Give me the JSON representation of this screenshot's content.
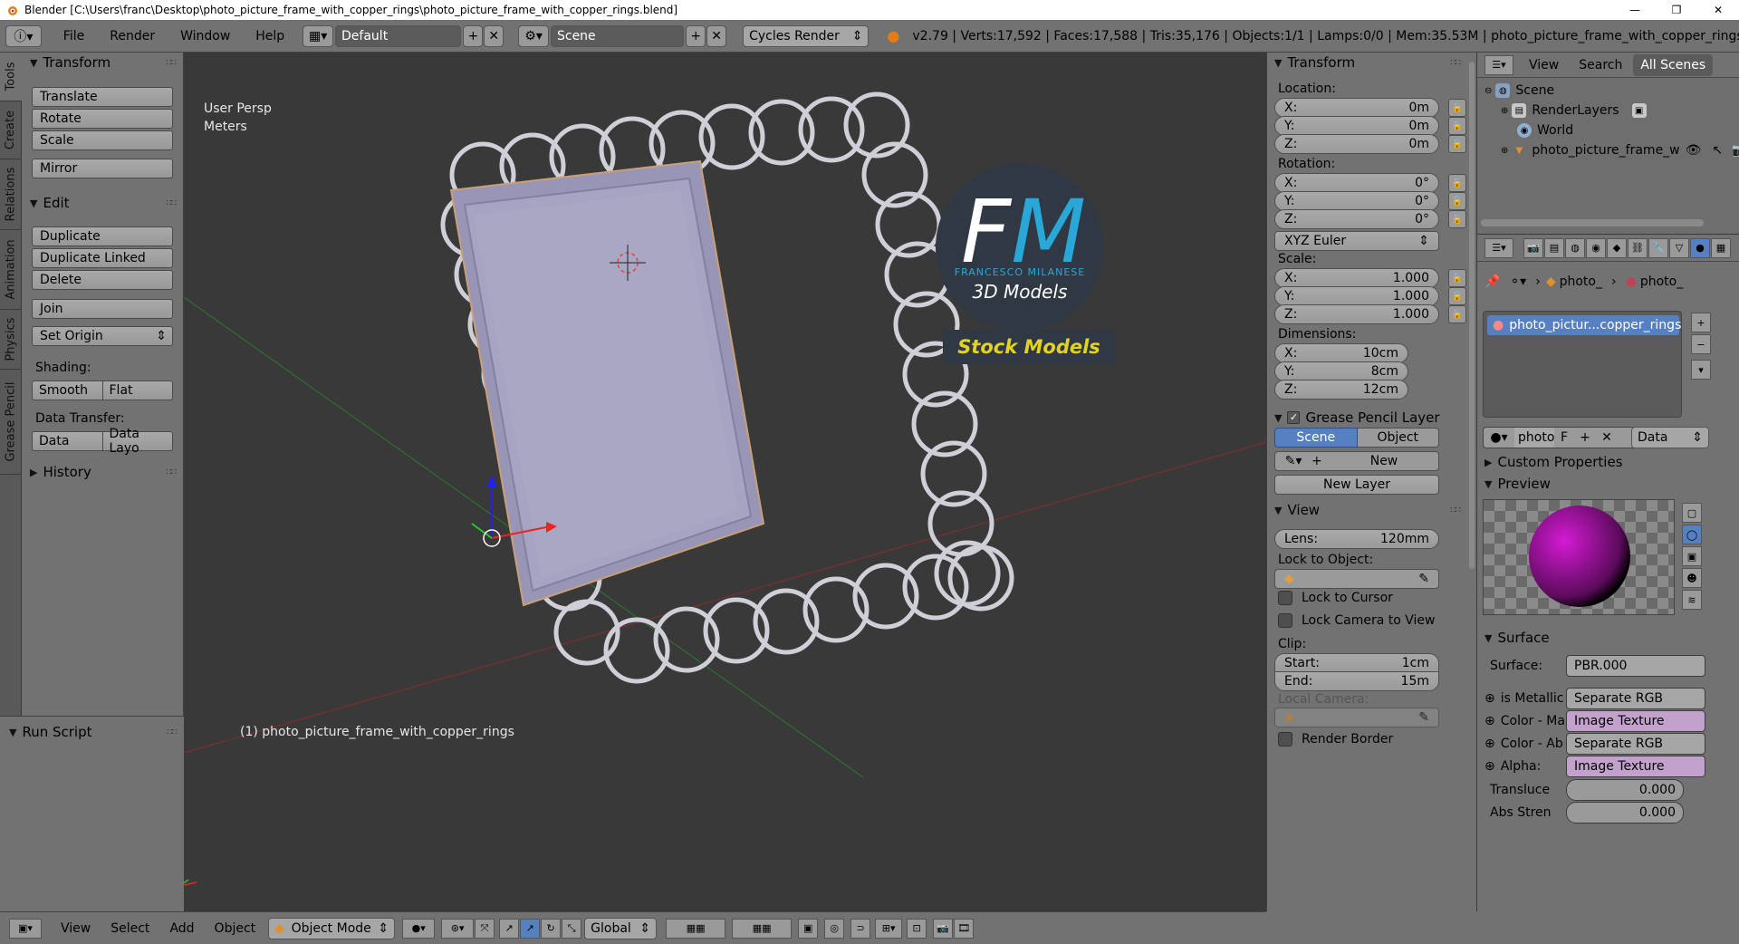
{
  "window": {
    "title": "Blender [C:\\Users\\franc\\Desktop\\photo_picture_frame_with_copper_rings\\photo_picture_frame_with_copper_rings.blend]",
    "minimize": "—",
    "maximize": "❐",
    "close": "✕"
  },
  "infobar": {
    "menus": [
      "File",
      "Render",
      "Window",
      "Help"
    ],
    "layout": "Default",
    "scene": "Scene",
    "engine": "Cycles Render",
    "stats": "v2.79 | Verts:17,592 | Faces:17,588 | Tris:35,176 | Objects:1/1 | Lamps:0/0 | Mem:35.53M | photo_picture_frame_with_copper_rings"
  },
  "vtabs": [
    "Tools",
    "Create",
    "Relations",
    "Animation",
    "Physics",
    "Grease Pencil"
  ],
  "toolshelf": {
    "transform_header": "Transform",
    "translate": "Translate",
    "rotate": "Rotate",
    "scale": "Scale",
    "mirror": "Mirror",
    "edit_header": "Edit",
    "duplicate": "Duplicate",
    "duplicate_linked": "Duplicate Linked",
    "delete": "Delete",
    "join": "Join",
    "set_origin": "Set Origin",
    "shading_label": "Shading:",
    "smooth": "Smooth",
    "flat": "Flat",
    "data_transfer_label": "Data Transfer:",
    "data": "Data",
    "data_layo": "Data Layo",
    "history_header": "History",
    "run_script_header": "Run Script"
  },
  "viewport": {
    "persp": "User Persp",
    "units": "Meters",
    "object_label": "(1) photo_picture_frame_with_copper_rings",
    "watermark": {
      "fm_f": "F",
      "fm_m": "M",
      "brand": "FRANCESCO MILANESE",
      "models": "3D Models",
      "stock": "Stock Models"
    }
  },
  "nprops": {
    "transform_header": "Transform",
    "location_label": "Location:",
    "loc": [
      {
        "k": "X:",
        "v": "0m"
      },
      {
        "k": "Y:",
        "v": "0m"
      },
      {
        "k": "Z:",
        "v": "0m"
      }
    ],
    "rotation_label": "Rotation:",
    "rot": [
      {
        "k": "X:",
        "v": "0°"
      },
      {
        "k": "Y:",
        "v": "0°"
      },
      {
        "k": "Z:",
        "v": "0°"
      }
    ],
    "rot_mode": "XYZ Euler",
    "scale_label": "Scale:",
    "scl": [
      {
        "k": "X:",
        "v": "1.000"
      },
      {
        "k": "Y:",
        "v": "1.000"
      },
      {
        "k": "Z:",
        "v": "1.000"
      }
    ],
    "dimensions_label": "Dimensions:",
    "dim": [
      {
        "k": "X:",
        "v": "10cm"
      },
      {
        "k": "Y:",
        "v": "8cm"
      },
      {
        "k": "Z:",
        "v": "12cm"
      }
    ],
    "gp_header": "Grease Pencil Layer",
    "gp_scene": "Scene",
    "gp_object": "Object",
    "gp_new": "New",
    "gp_new_layer": "New Layer",
    "view_header": "View",
    "lens_k": "Lens:",
    "lens_v": "120mm",
    "lock_to_object": "Lock to Object:",
    "lock_to_cursor": "Lock to Cursor",
    "lock_camera": "Lock Camera to View",
    "clip_label": "Clip:",
    "clip_start_k": "Start:",
    "clip_start_v": "1cm",
    "clip_end_k": "End:",
    "clip_end_v": "15m",
    "local_camera": "Local Camera:",
    "render_border": "Render Border"
  },
  "outliner": {
    "view": "View",
    "search": "Search",
    "all_scenes": "All Scenes",
    "scene": "Scene",
    "renderlayers": "RenderLayers",
    "world": "World",
    "object": "photo_picture_frame_w"
  },
  "material": {
    "crumb1": "photo_",
    "crumb2": "photo_",
    "slot": "photo_pictur...copper_rings",
    "name": "photo",
    "f": "F",
    "data": "Data",
    "custom_props": "Custom Properties",
    "preview": "Preview",
    "surface_header": "Surface",
    "surface_label": "Surface:",
    "surface_value": "PBR.000",
    "rows": [
      {
        "label": "is Metallic",
        "value": "Separate RGB",
        "color": "#a6a6a6"
      },
      {
        "label": "Color - Ma",
        "value": "Image Texture",
        "color": "#c2a2cc"
      },
      {
        "label": "Color - Ab",
        "value": "Separate RGB",
        "color": "#a6a6a6"
      },
      {
        "label": "Alpha:",
        "value": "Image Texture",
        "color": "#c2a2cc"
      }
    ],
    "translucency_k": "Transluce",
    "translucency_v": "0.000",
    "abs_k": "Abs Stren",
    "abs_v": "0.000"
  },
  "bottombar": {
    "view": "View",
    "select": "Select",
    "add": "Add",
    "object": "Object",
    "mode": "Object Mode",
    "orientation": "Global"
  },
  "colors": {
    "ui_gray": "#727272",
    "viewport_bg": "#393939",
    "active_blue": "#5680c2",
    "fm_cyan": "#29a8d8",
    "stock_yellow": "#e3d321",
    "frame_lilac": "#a7a3c3"
  }
}
